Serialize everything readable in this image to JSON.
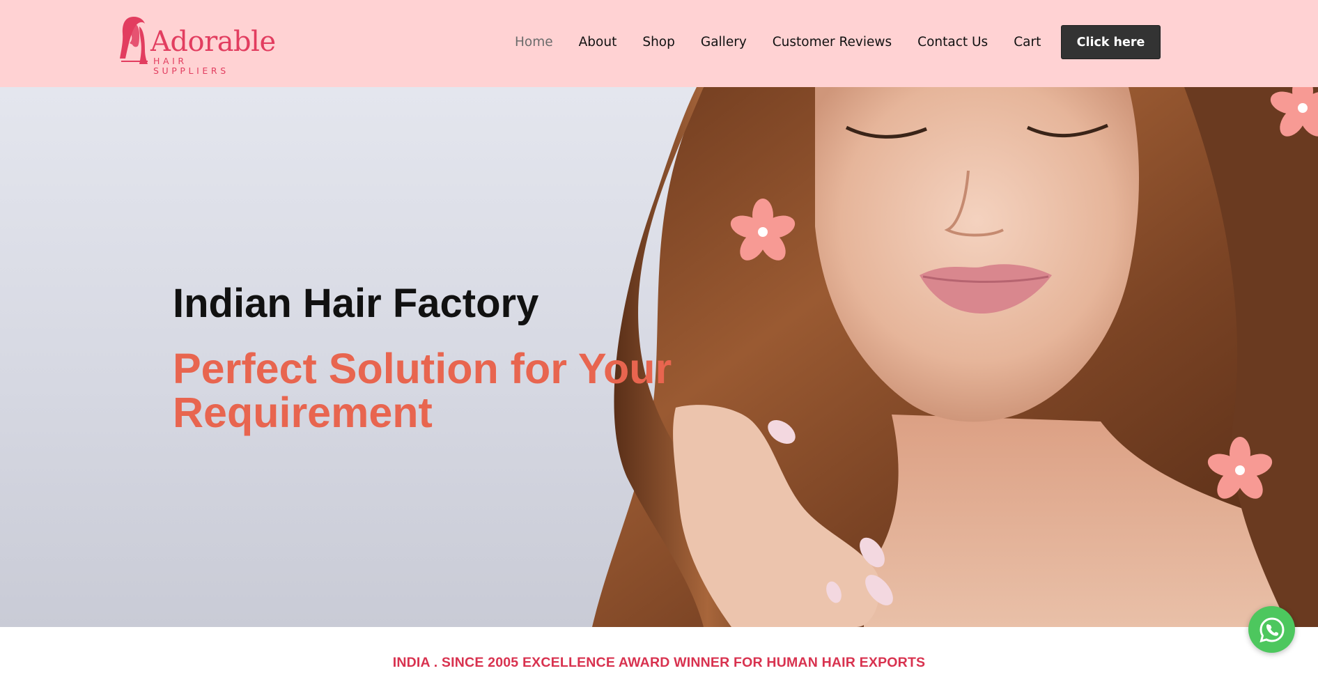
{
  "header": {
    "logo": {
      "word": "Adorable",
      "sub": "HAIR SUPPLIERS"
    },
    "nav": [
      {
        "label": "Home",
        "active": true
      },
      {
        "label": "About"
      },
      {
        "label": "Shop"
      },
      {
        "label": "Gallery"
      },
      {
        "label": "Customer Reviews"
      },
      {
        "label": "Contact Us"
      },
      {
        "label": "Cart"
      }
    ],
    "cta_label": "Click here"
  },
  "hero": {
    "title": "Indian Hair Factory",
    "subtitle": "Perfect Solution for Your Requirement"
  },
  "strip": {
    "text": "INDIA . SINCE 2005 EXCELLENCE AWARD WINNER FOR HUMAN HAIR EXPORTS"
  },
  "colors": {
    "header_bg": "#ffd2d3",
    "brand": "#e23d5f",
    "accent": "#e8654f",
    "cta_bg": "#333333",
    "whatsapp": "#4dc75e"
  },
  "icons": {
    "logo": "woman-silhouette-icon",
    "flower": "flower-icon",
    "whatsapp": "whatsapp-icon"
  }
}
